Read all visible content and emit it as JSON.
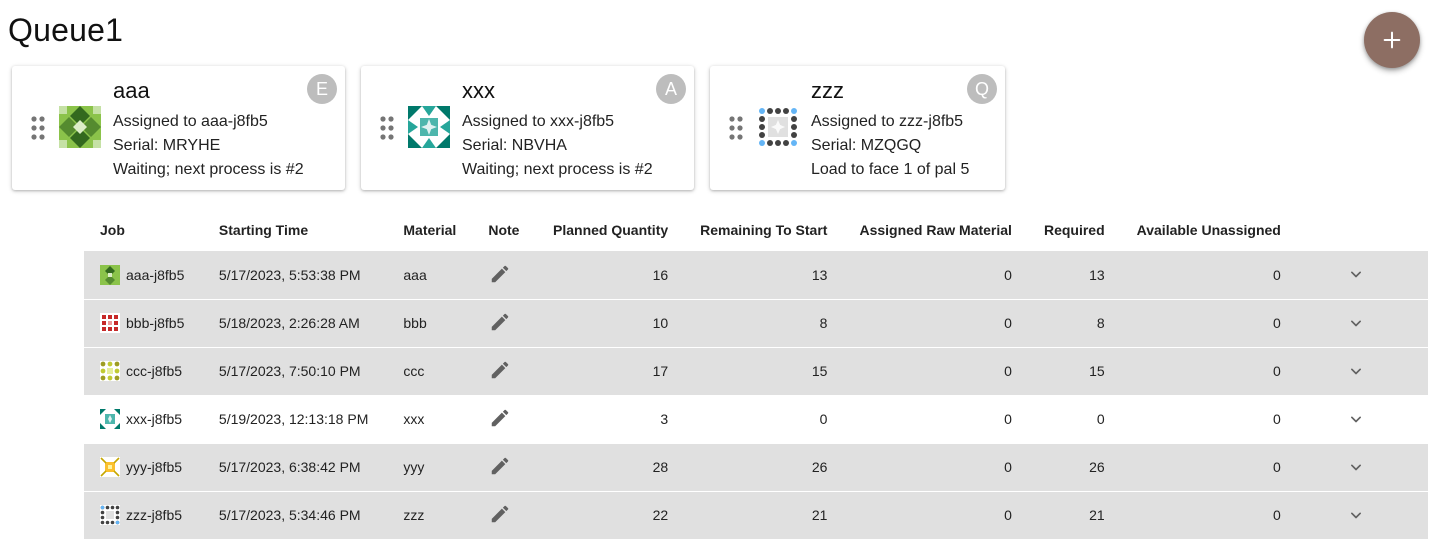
{
  "page": {
    "title": "Queue1"
  },
  "fab": {
    "icon": "plus-icon",
    "color": "#8d6e63"
  },
  "cards": [
    {
      "name": "aaa",
      "assigned": "Assigned to aaa-j8fb5",
      "serial": "Serial: MRYHE",
      "status": "Waiting; next process is #2",
      "badge": "E",
      "icon": "aaa-job-quilt-icon"
    },
    {
      "name": "xxx",
      "assigned": "Assigned to xxx-j8fb5",
      "serial": "Serial: NBVHA",
      "status": "Waiting; next process is #2",
      "badge": "A",
      "icon": "xxx-job-quilt-icon"
    },
    {
      "name": "zzz",
      "assigned": "Assigned to zzz-j8fb5",
      "serial": "Serial: MZQGQ",
      "status": "Load to face 1 of pal 5",
      "badge": "Q",
      "icon": "zzz-job-quilt-icon"
    }
  ],
  "table": {
    "headers": {
      "job": "Job",
      "start": "Starting Time",
      "material": "Material",
      "note": "Note",
      "planned": "Planned Quantity",
      "remaining": "Remaining To Start",
      "assigned": "Assigned Raw Material",
      "required": "Required",
      "available": "Available Unassigned"
    },
    "rows": [
      {
        "job": "aaa-j8fb5",
        "start": "5/17/2023, 5:53:38 PM",
        "material": "aaa",
        "planned": "16",
        "remaining": "13",
        "assigned": "0",
        "required": "13",
        "available": "0",
        "highlighted": true
      },
      {
        "job": "bbb-j8fb5",
        "start": "5/18/2023, 2:26:28 AM",
        "material": "bbb",
        "planned": "10",
        "remaining": "8",
        "assigned": "0",
        "required": "8",
        "available": "0",
        "highlighted": true
      },
      {
        "job": "ccc-j8fb5",
        "start": "5/17/2023, 7:50:10 PM",
        "material": "ccc",
        "planned": "17",
        "remaining": "15",
        "assigned": "0",
        "required": "15",
        "available": "0",
        "highlighted": true
      },
      {
        "job": "xxx-j8fb5",
        "start": "5/19/2023, 12:13:18 PM",
        "material": "xxx",
        "planned": "3",
        "remaining": "0",
        "assigned": "0",
        "required": "0",
        "available": "0",
        "highlighted": false
      },
      {
        "job": "yyy-j8fb5",
        "start": "5/17/2023, 6:38:42 PM",
        "material": "yyy",
        "planned": "28",
        "remaining": "26",
        "assigned": "0",
        "required": "26",
        "available": "0",
        "highlighted": true
      },
      {
        "job": "zzz-j8fb5",
        "start": "5/17/2023, 5:34:46 PM",
        "material": "zzz",
        "planned": "22",
        "remaining": "21",
        "assigned": "0",
        "required": "21",
        "available": "0",
        "highlighted": true
      }
    ]
  }
}
